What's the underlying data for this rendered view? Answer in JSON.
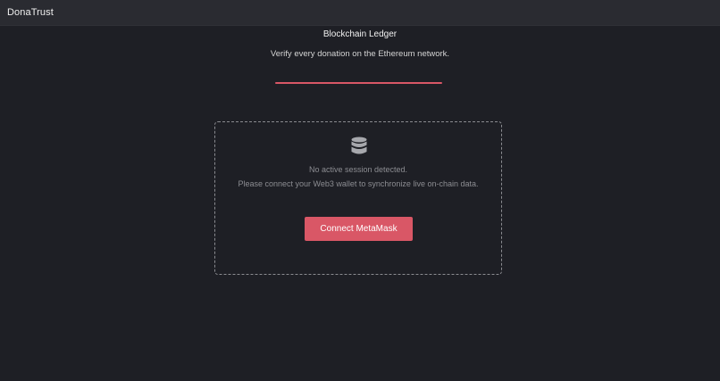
{
  "header": {
    "brand": "DonaTrust"
  },
  "main": {
    "title": "Blockchain Ledger",
    "subtitle": "Verify every donation on the Ethereum network."
  },
  "panel": {
    "icon": "database-icon",
    "status_line1": "No active session detected.",
    "status_line2": "Please connect your Web3 wallet to synchronize live on-chain data.",
    "connect_label": "Connect MetaMask"
  },
  "colors": {
    "background": "#1e1f25",
    "topbar": "#2a2b31",
    "accent": "#d95766",
    "muted_text": "#8c8d92",
    "panel_border": "#8a8b90"
  }
}
